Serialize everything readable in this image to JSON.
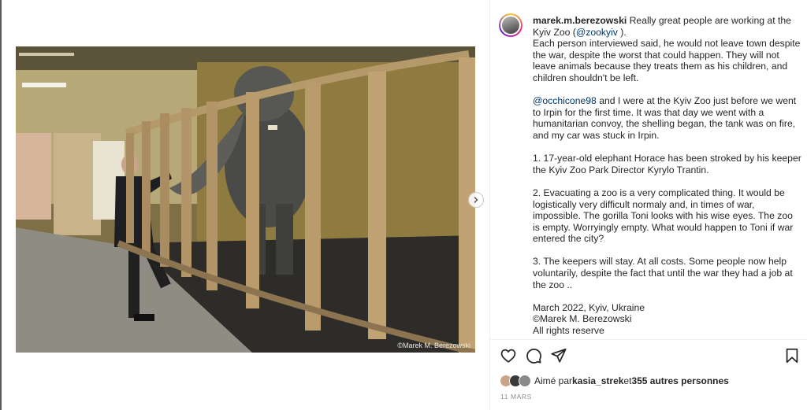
{
  "post": {
    "username": "marek.m.berezowski",
    "caption_intro": "Really great people are working at the Kyiv Zoo (",
    "caption_mention_zoo": "@zookyiv",
    "caption_intro_end": " ).",
    "caption_p1": "Each person interviewed said, he would not leave town despite the war, despite the worst that could happen. They will not leave animals because they treats them as his children, and children shouldn't be left.",
    "caption_mention_occhi": "@occhicone98",
    "caption_p2": " and I were at the Kyiv Zoo just before we went to Irpin for the first time. It was that day we went with a humanitarian convoy, the shelling began, the tank was on fire, and my car was stuck in Irpin.",
    "caption_p3": "1. 17-year-old elephant Horace has been stroked by his keeper the Kyiv Zoo Park Director Kyrylo Trantin.",
    "caption_p4": "2. Evacuating a zoo is a very complicated thing. It would be logistically very difficult normaly and, in times of war, impossible. The gorilla Toni looks with his wise eyes. The zoo is empty. Worryingly empty. What would happen to Toni if war entered the city?",
    "caption_p5": "3. The keepers will stay. At all costs. Some people now help voluntarily, despite the fact that until the war they had a job at the zoo ..",
    "caption_p6": "March 2022, Kyiv, Ukraine\n©Marek M. Berezowski\nAll rights reserve"
  },
  "photo": {
    "watermark": "©Marek M. Berezowski",
    "icon": "elephant-photo"
  },
  "likes": {
    "prefix": "Aimé par ",
    "user": "kasia_strek",
    "middle": " et ",
    "others": "355 autres personnes"
  },
  "date": "11 MARS",
  "icons": {
    "like": "heart-icon",
    "comment": "comment-icon",
    "share": "share-icon",
    "save": "bookmark-icon",
    "next": "chevron-right-icon"
  },
  "colors": {
    "text": "#262626",
    "mention": "#00376b",
    "muted": "#8e8e8e"
  }
}
